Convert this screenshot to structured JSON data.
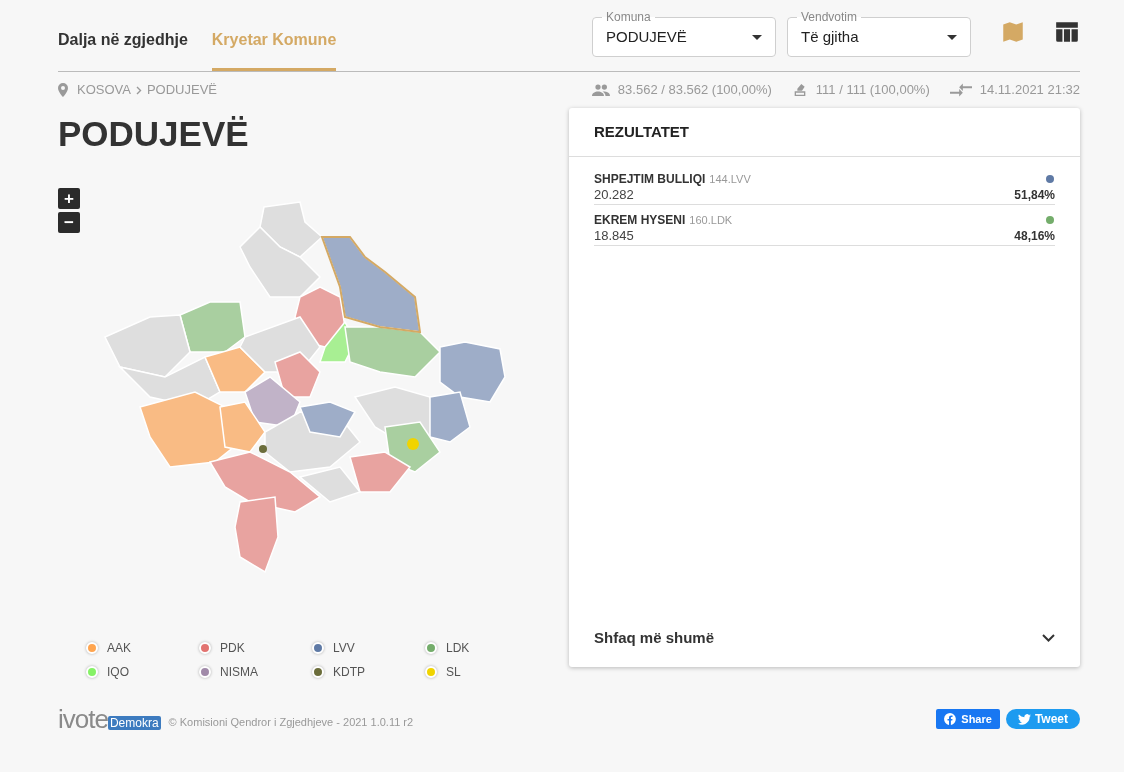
{
  "tabs": [
    {
      "label": "Dalja në zgjedhje",
      "selected": false
    },
    {
      "label": "Kryetar Komune",
      "selected": true
    }
  ],
  "filters": [
    {
      "label": "Komuna",
      "value": "PODUJEVË"
    },
    {
      "label": "Vendvotim",
      "value": "Të gjitha"
    }
  ],
  "view_toggles": [
    {
      "kind": "map",
      "selected": true
    },
    {
      "kind": "table",
      "selected": false
    }
  ],
  "breadcrumb": [
    "KOSOVA",
    "PODUJEVË"
  ],
  "stats": [
    {
      "kind": "voters",
      "text": "83.562 / 83.562 (100,00%)"
    },
    {
      "kind": "stations",
      "text": "111 / 111 (100,00%)"
    },
    {
      "kind": "updated",
      "text": "14.11.2021 21:32"
    }
  ],
  "title": "PODUJEVË",
  "zoom_controls": [
    "+",
    "−"
  ],
  "results": {
    "title": "REZULTATET",
    "candidates": [
      {
        "name": "SHPEJTIM BULLIQI",
        "party": "144.LVV",
        "votes": "20.282",
        "percent": "51,84%",
        "color": "#5f7aa5"
      },
      {
        "name": "EKREM HYSENI",
        "party": "160.LDK",
        "votes": "18.845",
        "percent": "48,16%",
        "color": "#74ad6b"
      }
    ],
    "show_more": "Shfaq më shumë"
  },
  "legend": [
    {
      "label": "AAK",
      "color": "#ffa54f"
    },
    {
      "label": "PDK",
      "color": "#e27370"
    },
    {
      "label": "LVV",
      "color": "#5f7aa5"
    },
    {
      "label": "LDK",
      "color": "#74ad6b"
    },
    {
      "label": "IQO",
      "color": "#86f266"
    },
    {
      "label": "NISMA",
      "color": "#a18aa9"
    },
    {
      "label": "KDTP",
      "color": "#6b6d3b"
    },
    {
      "label": "SL",
      "color": "#f0d400"
    }
  ],
  "footer": {
    "logo_text": "ivote",
    "logo_badge": "Demokra",
    "copyright": "© Komisioni Qendror i Zgjedhjeve - 2021 1.0.11 r2",
    "share": [
      "Share",
      "Tweet"
    ]
  }
}
